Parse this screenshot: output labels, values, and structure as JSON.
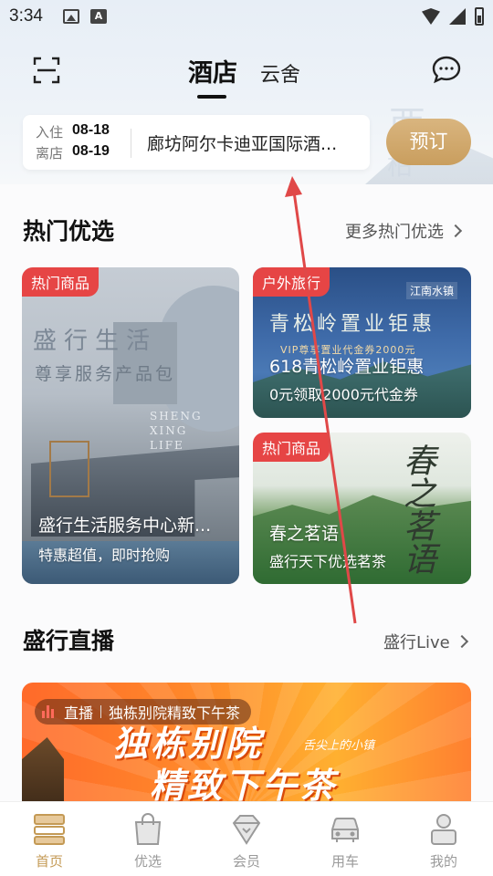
{
  "status_bar": {
    "time": "3:34"
  },
  "header": {
    "tabs": [
      {
        "label": "酒店",
        "active": true
      },
      {
        "label": "云舍",
        "active": false
      }
    ],
    "watermark": "西",
    "watermark2": "柏"
  },
  "booking": {
    "checkin_label": "入住",
    "checkin_date": "08-18",
    "checkout_label": "离店",
    "checkout_date": "08-19",
    "hotel_name": "廊坊阿尔卡迪亚国际酒...",
    "book_button": "预订"
  },
  "hot": {
    "title": "热门优选",
    "more": "更多热门优选",
    "cards": [
      {
        "tag": "热门商品",
        "title": "盛行生活服务中心新...",
        "subtitle": "特惠超值，即时抢购",
        "image_text": "盛行生活",
        "image_subtext": "尊享服务产品包",
        "image_en": [
          "SHENG",
          "XING",
          "LIFE"
        ]
      },
      {
        "tag": "户外旅行",
        "title": "618青松岭置业钜惠",
        "subtitle": "0元领取2000元代金券",
        "image_text": "青松岭置业钜惠",
        "image_vip": "VIP尊享置业代金券2000元",
        "image_brand": "江南水镇"
      },
      {
        "tag": "热门商品",
        "title": "春之茗语",
        "subtitle": "盛行天下优选茗茶",
        "image_text": "春之茗语"
      }
    ]
  },
  "live": {
    "title": "盛行直播",
    "more": "盛行Live",
    "badge_live": "直播",
    "badge_text": "独栋别院精致下午茶",
    "banner_line1": "独栋别院",
    "banner_line2": "精致下午茶",
    "banner_tag": "舌尖上的小镇"
  },
  "bottom_nav": [
    {
      "label": "首页",
      "icon": "home-icon",
      "active": true
    },
    {
      "label": "优选",
      "icon": "shopping-bag-icon",
      "active": false
    },
    {
      "label": "会员",
      "icon": "diamond-icon",
      "active": false
    },
    {
      "label": "用车",
      "icon": "car-icon",
      "active": false
    },
    {
      "label": "我的",
      "icon": "user-icon",
      "active": false
    }
  ],
  "colors": {
    "accent_gold": "#c99e5e",
    "tag_red": "#e64545",
    "annotation_arrow": "#e04848"
  }
}
